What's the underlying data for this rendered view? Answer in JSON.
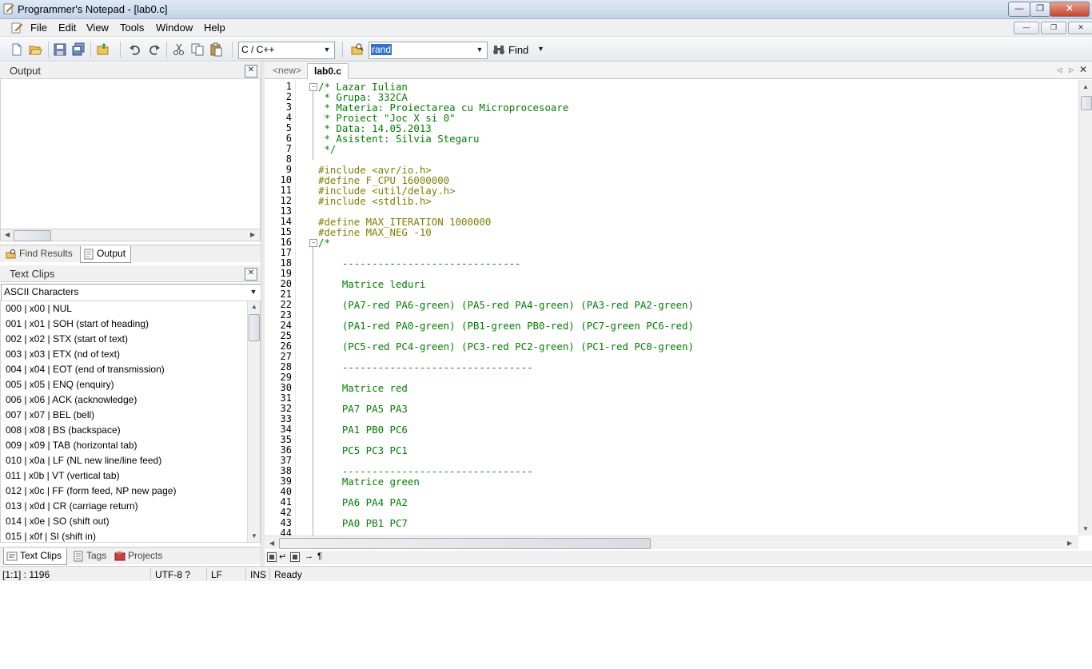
{
  "window": {
    "title": "Programmer's Notepad - [lab0.c]"
  },
  "menu": [
    "File",
    "Edit",
    "View",
    "Tools",
    "Window",
    "Help"
  ],
  "toolbar": {
    "scheme": "C / C++",
    "search_value": "rand",
    "find_label": "Find"
  },
  "output_panel": {
    "title": "Output",
    "tabs": [
      "Find Results",
      "Output"
    ]
  },
  "textclips_panel": {
    "title": "Text Clips",
    "category": "ASCII Characters",
    "items": [
      "000 | x00 | NUL",
      "001 | x01 | SOH (start of heading)",
      "002 | x02 | STX (start of text)",
      "003 | x03 | ETX (nd of text)",
      "004 | x04 | EOT (end of transmission)",
      "005 | x05 | ENQ (enquiry)",
      "006 | x06 | ACK (acknowledge)",
      "007 | x07 | BEL (bell)",
      "008 | x08 | BS (backspace)",
      "009 | x09 | TAB (horizontal tab)",
      "010 | x0a | LF (NL new line/line feed)",
      "011 | x0b | VT (vertical tab)",
      "012 | x0c | FF (form feed, NP new page)",
      "013 | x0d | CR (carriage return)",
      "014 | x0e | SO (shift out)",
      "015 | x0f | SI (shift in)"
    ],
    "tabs": [
      "Text Clips",
      "Tags",
      "Projects"
    ]
  },
  "editor": {
    "tabs": [
      "<new>",
      "lab0.c"
    ],
    "lines": [
      {
        "t": "/* Lazar Iulian",
        "k": "comment"
      },
      {
        "t": " * Grupa: 332CA",
        "k": "comment"
      },
      {
        "t": " * Materia: Proiectarea cu Microprocesoare",
        "k": "comment"
      },
      {
        "t": " * Proiect \"Joc X si 0\"",
        "k": "comment"
      },
      {
        "t": " * Data: 14.05.2013",
        "k": "comment"
      },
      {
        "t": " * Asistent: Silvia Stegaru",
        "k": "comment"
      },
      {
        "t": " */",
        "k": "comment"
      },
      {
        "t": "",
        "k": "comment"
      },
      {
        "t": "#include <avr/io.h>",
        "k": "pre"
      },
      {
        "t": "#define F_CPU 16000000",
        "k": "pre"
      },
      {
        "t": "#include <util/delay.h>",
        "k": "pre"
      },
      {
        "t": "#include <stdlib.h>",
        "k": "pre"
      },
      {
        "t": "",
        "k": "pre"
      },
      {
        "t": "#define MAX_ITERATION 1000000",
        "k": "pre"
      },
      {
        "t": "#define MAX_NEG -10",
        "k": "pre"
      },
      {
        "t": "/*",
        "k": "comment"
      },
      {
        "t": "",
        "k": "comment"
      },
      {
        "t": "    ------------------------------",
        "k": "comment"
      },
      {
        "t": "",
        "k": "comment"
      },
      {
        "t": "    Matrice leduri",
        "k": "comment"
      },
      {
        "t": "",
        "k": "comment"
      },
      {
        "t": "    (PA7-red PA6-green) (PA5-red PA4-green) (PA3-red PA2-green)",
        "k": "comment"
      },
      {
        "t": "",
        "k": "comment"
      },
      {
        "t": "    (PA1-red PA0-green) (PB1-green PB0-red) (PC7-green PC6-red)",
        "k": "comment"
      },
      {
        "t": "",
        "k": "comment"
      },
      {
        "t": "    (PC5-red PC4-green) (PC3-red PC2-green) (PC1-red PC0-green)",
        "k": "comment"
      },
      {
        "t": "",
        "k": "comment"
      },
      {
        "t": "    --------------------------------",
        "k": "comment"
      },
      {
        "t": "",
        "k": "comment"
      },
      {
        "t": "    Matrice red",
        "k": "comment"
      },
      {
        "t": "",
        "k": "comment"
      },
      {
        "t": "    PA7 PA5 PA3",
        "k": "comment"
      },
      {
        "t": "",
        "k": "comment"
      },
      {
        "t": "    PA1 PB0 PC6",
        "k": "comment"
      },
      {
        "t": "",
        "k": "comment"
      },
      {
        "t": "    PC5 PC3 PC1",
        "k": "comment"
      },
      {
        "t": "",
        "k": "comment"
      },
      {
        "t": "    --------------------------------",
        "k": "comment"
      },
      {
        "t": "    Matrice green",
        "k": "comment"
      },
      {
        "t": "",
        "k": "comment"
      },
      {
        "t": "    PA6 PA4 PA2",
        "k": "comment"
      },
      {
        "t": "",
        "k": "comment"
      },
      {
        "t": "    PA0 PB1 PC7",
        "k": "comment"
      },
      {
        "t": "",
        "k": "comment"
      }
    ],
    "line_numbers": [
      "1",
      "2",
      "3",
      "4",
      "5",
      "6",
      "7",
      "8",
      "9",
      "10",
      "11",
      "12",
      "13",
      "14",
      "15",
      "16",
      "17",
      "18",
      "19",
      "20",
      "21",
      "22",
      "23",
      "24",
      "25",
      "26",
      "27",
      "28",
      "29",
      "30",
      "31",
      "32",
      "33",
      "34",
      "35",
      "36",
      "37",
      "38",
      "39",
      "40",
      "41",
      "42",
      "43",
      "44"
    ],
    "bottom_symbol": "¶"
  },
  "status": {
    "position": "[1:1] : 1196",
    "encoding": "UTF-8 ?",
    "eol": "LF",
    "mode": "INS",
    "state": "Ready"
  },
  "colors": {
    "comment": "#008000",
    "preprocessor": "#808000"
  }
}
